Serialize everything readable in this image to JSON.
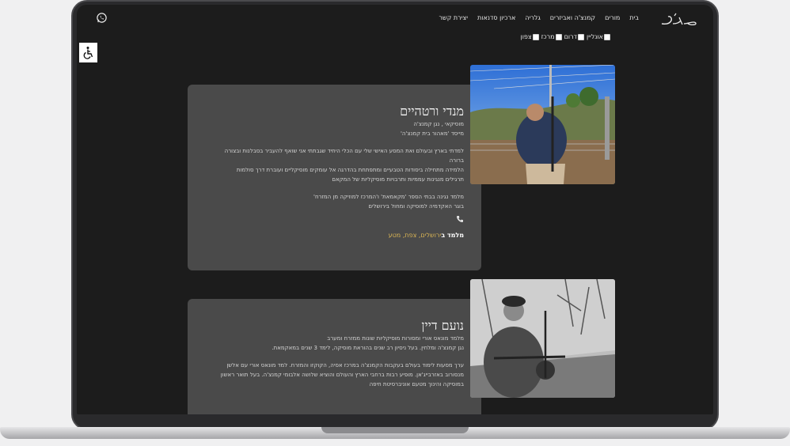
{
  "nav": {
    "items": [
      "בית",
      "מורים",
      "קמנצ'ה ואביזרים",
      "גלריה",
      "ארכיון סדנאות",
      "יצירת קשר"
    ]
  },
  "filters": [
    "אונליין",
    "דרום",
    "מרכז",
    "צפון"
  ],
  "teachers": [
    {
      "name": "מנדי ורטהיים",
      "lines": [
        "מוסיקאי , נגן קמנצ'ה",
        "מייסד 'מאהור בית קמנצ'ה'"
      ],
      "para1": [
        "למדתי בארץ ובעולם ואת המסע האישי שלי עם הכלי היחיד שגבתתי אני שואף להעביר בסבלנות ובצורה",
        "ברורה",
        "הלמידה מתחילה ביסודות הטבעיים ומתפתחת בהדרגה אל עומקים מוסיקליים ועוברת דרך סולמות",
        "תרגילים מנגינות עממיות ותרבויות מוסיקליות של המקאם"
      ],
      "para2": [
        "מלמד נגינה בבתי הספר 'מקאמאת' ו'המרכז למוזיקה מן המזרח'",
        "בוגר האקדמיה למוסיקה ומחול בירושלים"
      ],
      "teaches_label": "מלמד ב",
      "teaches_places": "ירושלים, צפת, מטע"
    },
    {
      "name": "נועם דיין",
      "lines": [
        "מלמד מונאס אורי ומסורות מוסיקליות שונות ממזרח ומערב",
        "נגן קמנצ'ה ומלחין. בעל ניסיון רב שנים בהוראת מוסיקה, לימד 3 שנים במאקמאת."
      ],
      "para1": [
        "ערך מסעות לימוד בעולם בעקבות הקמנצ'ה במרכז אסיה, הקוקזו והמזרח. למד מונאס אורי עם אלשן",
        "מנסורוב באזרבייג'אן. מופיע רבות ברחבי הארץ והעולם והוציא שלושה אלבומי קמנצ'ה. בעל תואר ראשון",
        "במוסיקה והינוך מטעם אוניברסיטת חיפה"
      ]
    }
  ]
}
